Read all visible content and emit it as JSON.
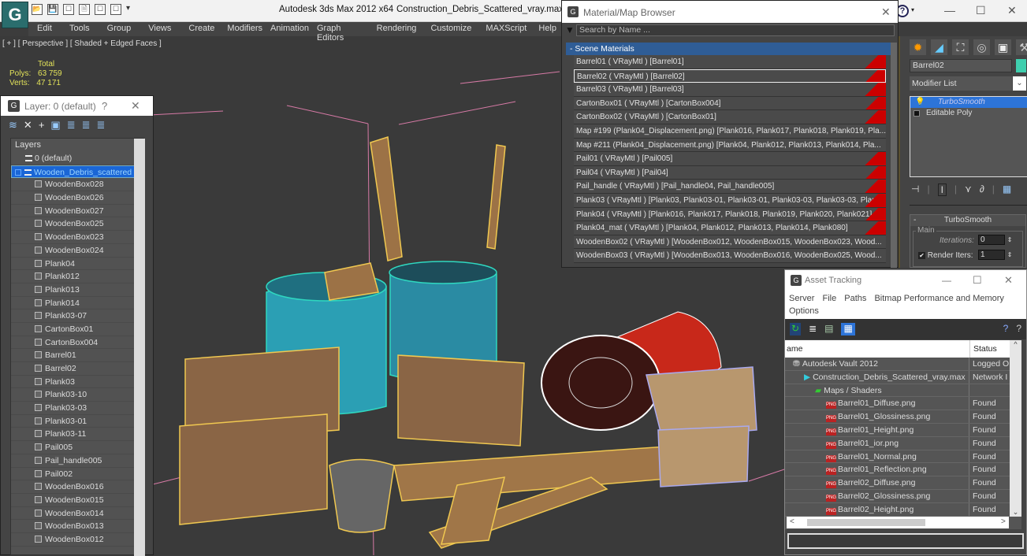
{
  "app": {
    "title": "Autodesk 3ds Max  2012 x64",
    "file": "Construction_Debris_Scattered_vray.max",
    "logo_glyph": "G",
    "help_glyph": "?",
    "help_arrow": "▾",
    "win_min": "—",
    "win_max": "☐",
    "win_close": "✕"
  },
  "quick_access": [
    "📂",
    "💾",
    "☐",
    "🗎",
    "☐",
    "☐",
    "▾"
  ],
  "menu": [
    "Edit",
    "Tools",
    "Group",
    "Views",
    "Create",
    "Modifiers",
    "Animation",
    "Graph Editors",
    "Rendering",
    "Customize",
    "MAXScript",
    "Help"
  ],
  "viewport": {
    "label": "[ + ] [ Perspective ] [ Shaded + Edged Faces ]",
    "stats_total": "Total",
    "polys_label": "Polys:",
    "polys_value": "63 759",
    "verts_label": "Verts:",
    "verts_value": "47 171"
  },
  "layer_panel": {
    "title": "Layer: 0 (default)",
    "help": "?",
    "close": "✕",
    "toolbar": [
      "≋",
      "✕",
      "+",
      "▣",
      "≣",
      "≣",
      "≣"
    ],
    "header": "Layers",
    "layers": [
      {
        "name": "0 (default)",
        "type": "layer"
      },
      {
        "name": "Wooden_Debris_scattered",
        "type": "layer",
        "selected": true
      }
    ],
    "objects": [
      "WoodenBox028",
      "WoodenBox026",
      "WoodenBox027",
      "WoodenBox025",
      "WoodenBox023",
      "WoodenBox024",
      "Plank04",
      "Plank012",
      "Plank013",
      "Plank014",
      "Plank03-07",
      "CartonBox01",
      "CartonBox004",
      "Barrel01",
      "Barrel02",
      "Plank03",
      "Plank03-10",
      "Plank03-03",
      "Plank03-01",
      "Plank03-11",
      "Pail005",
      "Pail_handle005",
      "Pail002",
      "WoodenBox016",
      "WoodenBox015",
      "WoodenBox014",
      "WoodenBox013",
      "WoodenBox012"
    ]
  },
  "material_browser": {
    "title": "Material/Map Browser",
    "close": "✕",
    "search_placeholder": "Search by Name ...",
    "section": "- Scene Materials",
    "rows": [
      {
        "text": "Barrel01  ( VRayMtl )  [Barrel01]",
        "red": true
      },
      {
        "text": "Barrel02  ( VRayMtl )  [Barrel02]",
        "red": true,
        "selected": true
      },
      {
        "text": "Barrel03  ( VRayMtl )  [Barrel03]",
        "red": true
      },
      {
        "text": "CartonBox01  ( VRayMtl )  [CartonBox004]",
        "red": true
      },
      {
        "text": "CartonBox02  ( VRayMtl )  [CartonBox01]",
        "red": true
      },
      {
        "text": "Map #199 (Plank04_Displacement.png)  [Plank016, Plank017, Plank018, Plank019, Pla...",
        "red": false
      },
      {
        "text": "Map #211 (Plank04_Displacement.png)  [Plank04, Plank012, Plank013, Plank014, Pla...",
        "red": false
      },
      {
        "text": "Pail01  ( VRayMtl )  [Pail005]",
        "red": true
      },
      {
        "text": "Pail04  ( VRayMtl )  [Pail04]",
        "red": true
      },
      {
        "text": "Pail_handle  ( VRayMtl )  [Pail_handle04, Pail_handle005]",
        "red": true
      },
      {
        "text": "Plank03  ( VRayMtl )  [Plank03, Plank03-01, Plank03-01, Plank03-03, Plank03-03, Plan...",
        "red": true
      },
      {
        "text": "Plank04  ( VRayMtl )  [Plank016, Plank017, Plank018, Plank019, Plank020, Plank021]",
        "red": true
      },
      {
        "text": "Plank04_mat  ( VRayMtl )  [Plank04, Plank012, Plank013, Plank014, Plank080]",
        "red": true
      },
      {
        "text": "WoodenBox02  ( VRayMtl )  [WoodenBox012, WoodenBox015, WoodenBox023, Wood...",
        "red": false
      },
      {
        "text": "WoodenBox03  ( VRayMtl )  [WoodenBox013, WoodenBox016, WoodenBox025, Wood...",
        "red": false
      }
    ]
  },
  "command_panel": {
    "tabs": [
      "✹",
      "◢",
      "⛶",
      "◎",
      "▣",
      "⚒"
    ],
    "object_name": "Barrel02",
    "object_color": "#3fcfae",
    "modifier_list": "Modifier List",
    "dropdown": "⌄",
    "stack": [
      {
        "name": "TurboSmooth",
        "selected": true
      },
      {
        "name": "Editable Poly",
        "selected": false
      }
    ],
    "stack_tools": [
      "⊣",
      "|",
      "I",
      "|",
      "⋎",
      "∂",
      "|",
      "▦"
    ],
    "rollout_title": "TurboSmooth",
    "rollout_collapse": "-",
    "group_label": "Main",
    "iterations_label": "Iterations:",
    "iterations_value": "0",
    "render_iters_label": "Render Iters:",
    "render_iters_value": "1",
    "render_iters_checked": true
  },
  "asset_tracking": {
    "title": "Asset Tracking",
    "min": "—",
    "max": "☐",
    "close": "✕",
    "menu": [
      "Server",
      "File",
      "Paths",
      "Bitmap Performance and Memory",
      "Options"
    ],
    "col_name": "ame",
    "col_status": "Status",
    "rows": [
      {
        "name": "Autodesk Vault 2012",
        "status": "Logged O",
        "indent": 0,
        "icon": "vault"
      },
      {
        "name": "Construction_Debris_Scattered_vray.max",
        "status": "Network I",
        "indent": 1,
        "icon": "max"
      },
      {
        "name": "Maps / Shaders",
        "status": "",
        "indent": 2,
        "icon": "maps"
      },
      {
        "name": "Barrel01_Diffuse.png",
        "status": "Found",
        "indent": 3,
        "icon": "png"
      },
      {
        "name": "Barrel01_Glossiness.png",
        "status": "Found",
        "indent": 3,
        "icon": "png"
      },
      {
        "name": "Barrel01_Height.png",
        "status": "Found",
        "indent": 3,
        "icon": "png"
      },
      {
        "name": "Barrel01_ior.png",
        "status": "Found",
        "indent": 3,
        "icon": "png"
      },
      {
        "name": "Barrel01_Normal.png",
        "status": "Found",
        "indent": 3,
        "icon": "png"
      },
      {
        "name": "Barrel01_Reflection.png",
        "status": "Found",
        "indent": 3,
        "icon": "png"
      },
      {
        "name": "Barrel02_Diffuse.png",
        "status": "Found",
        "indent": 3,
        "icon": "png"
      },
      {
        "name": "Barrel02_Glossiness.png",
        "status": "Found",
        "indent": 3,
        "icon": "png"
      },
      {
        "name": "Barrel02_Height.png",
        "status": "Found",
        "indent": 3,
        "icon": "png"
      }
    ]
  },
  "colors": {
    "selection_blue": "#1a66d6",
    "wire_yellow": "#e8c25a",
    "barrel_teal": "#2fb8c8",
    "barrel_red": "#c8281a",
    "grid_pink": "#d77aa6"
  }
}
